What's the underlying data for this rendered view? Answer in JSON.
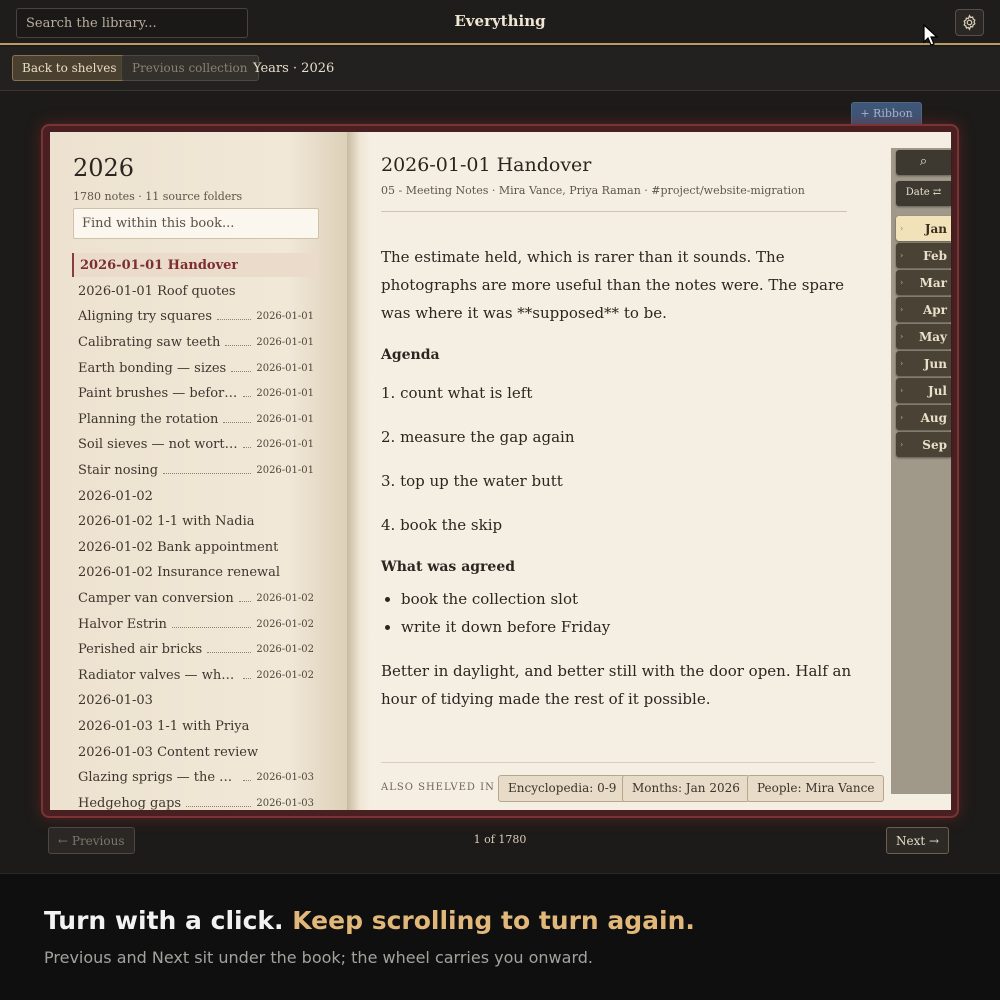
{
  "header": {
    "search_placeholder": "Search the library...",
    "title": "Everything",
    "settings_icon": "gear-icon"
  },
  "nav": {
    "back_label": "Back to shelves",
    "previous_collection_label": "Previous collection",
    "breadcrumb": "Years · 2026"
  },
  "ribbon": {
    "label": "+ Ribbon"
  },
  "left_page": {
    "year": "2026",
    "meta": "1780 notes · 11 source folders",
    "find_placeholder": "Find within this book...",
    "items": [
      {
        "title": "2026-01-01 Handover",
        "date": "",
        "active": true
      },
      {
        "title": "2026-01-01 Roof quotes",
        "date": ""
      },
      {
        "title": "Aligning try squares",
        "date": "2026-01-01"
      },
      {
        "title": "Calibrating saw teeth",
        "date": "2026-01-01"
      },
      {
        "title": "Earth bonding — sizes",
        "date": "2026-01-01"
      },
      {
        "title": "Paint brushes — before a...",
        "date": "2026-01-01"
      },
      {
        "title": "Planning the rotation",
        "date": "2026-01-01"
      },
      {
        "title": "Soil sieves — not worth it",
        "date": "2026-01-01"
      },
      {
        "title": "Stair nosing",
        "date": "2026-01-01"
      },
      {
        "title": "2026-01-02",
        "date": ""
      },
      {
        "title": "2026-01-02 1-1 with Nadia",
        "date": ""
      },
      {
        "title": "2026-01-02 Bank appointment",
        "date": ""
      },
      {
        "title": "2026-01-02 Insurance renewal",
        "date": ""
      },
      {
        "title": "Camper van conversion",
        "date": "2026-01-02"
      },
      {
        "title": "Halvor Estrin",
        "date": "2026-01-02"
      },
      {
        "title": "Perished air bricks",
        "date": "2026-01-02"
      },
      {
        "title": "Radiator valves — what i...",
        "date": "2026-01-02"
      },
      {
        "title": "2026-01-03",
        "date": ""
      },
      {
        "title": "2026-01-03 1-1 with Priya",
        "date": ""
      },
      {
        "title": "2026-01-03 Content review",
        "date": ""
      },
      {
        "title": "Glazing sprigs — the quote",
        "date": "2026-01-03"
      },
      {
        "title": "Hedgehog gaps",
        "date": "2026-01-03"
      }
    ]
  },
  "note": {
    "title": "2026-01-01 Handover",
    "meta": "05 - Meeting Notes · Mira Vance, Priya Raman · #project/website-migration",
    "intro": "The estimate held, which is rarer than it sounds. The photographs are more useful than the notes were. The spare was where it was **supposed** to be.",
    "agenda_heading": "Agenda",
    "agenda": [
      "1. count what is left",
      "2. measure the gap again",
      "3. top up the water butt",
      "4. book the skip"
    ],
    "agreed_heading": "What was agreed",
    "agreed": [
      "book the collection slot",
      "write it down before Friday"
    ],
    "closing": "Better in daylight, and better still with the door open. Half an hour of tidying made the rest of it possible.",
    "also_shelved_label": "ALSO SHELVED IN",
    "shelves": [
      "Encyclopedia: 0-9",
      "Months: Jan 2026",
      "People: Mira Vance"
    ]
  },
  "tabs": {
    "search_glyph": "⌕",
    "sort_label": "Date ⇄",
    "months": [
      "Jan",
      "Feb",
      "Mar",
      "Apr",
      "May",
      "Jun",
      "Jul",
      "Aug",
      "Sep"
    ],
    "active_month": "Jan"
  },
  "pager": {
    "previous_label": "← Previous",
    "count": "1 of 1780",
    "next_label": "Next →"
  },
  "footer": {
    "headline_main": "Turn with a click.",
    "headline_accent": "Keep scrolling to turn again.",
    "subline": "Previous and Next sit under the book; the wheel carries you onward."
  },
  "colors": {
    "accent_gold": "#e2b87a",
    "book_border": "#7a3436",
    "active_item": "#7d2f2f",
    "ribbon": "#3f5677"
  }
}
